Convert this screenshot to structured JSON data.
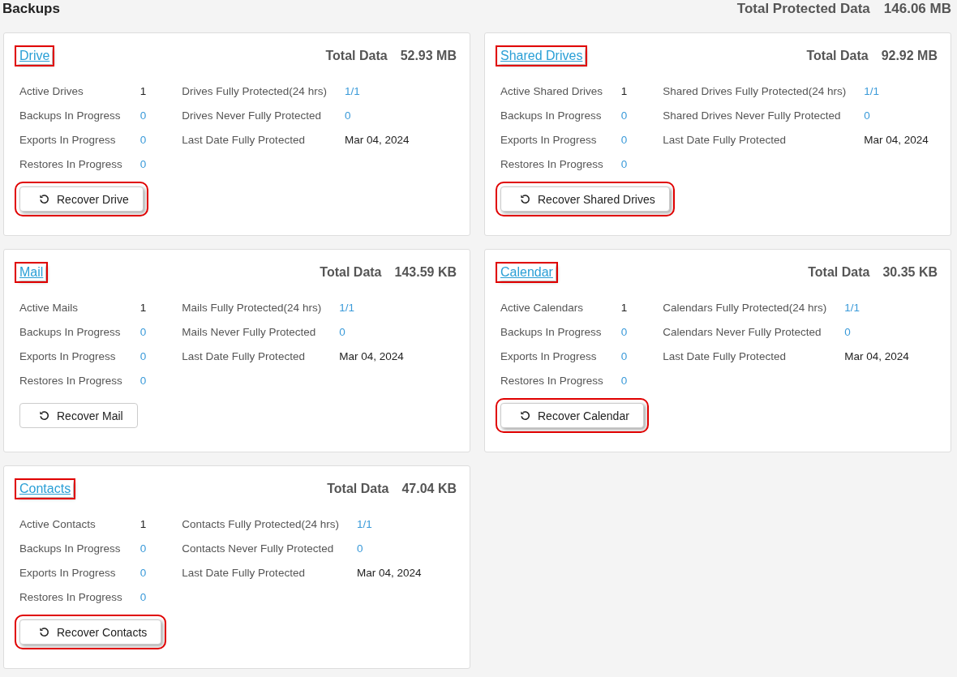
{
  "header": {
    "title": "Backups",
    "total_label": "Total Protected Data",
    "total_value": "146.06 MB"
  },
  "cards": [
    {
      "title": "Drive",
      "title_highlighted": true,
      "total_label": "Total Data",
      "total_value": "52.93 MB",
      "left_stats": [
        {
          "label": "Active Drives",
          "value": "1",
          "link": false
        },
        {
          "label": "Backups In Progress",
          "value": "0",
          "link": true
        },
        {
          "label": "Exports In Progress",
          "value": "0",
          "link": true
        },
        {
          "label": "Restores In Progress",
          "value": "0",
          "link": true
        }
      ],
      "right_stats": [
        {
          "label": "Drives Fully Protected(24 hrs)",
          "value": "1/1",
          "link": true
        },
        {
          "label": "Drives Never Fully Protected",
          "value": "0",
          "link": true
        },
        {
          "label": "Last Date Fully Protected",
          "value": "Mar 04, 2024",
          "link": false
        }
      ],
      "button": {
        "label": "Recover Drive",
        "highlighted": true
      }
    },
    {
      "title": "Shared Drives",
      "title_highlighted": true,
      "total_label": "Total Data",
      "total_value": "92.92 MB",
      "left_stats": [
        {
          "label": "Active Shared Drives",
          "value": "1",
          "link": false
        },
        {
          "label": "Backups In Progress",
          "value": "0",
          "link": true
        },
        {
          "label": "Exports In Progress",
          "value": "0",
          "link": true
        },
        {
          "label": "Restores In Progress",
          "value": "0",
          "link": true
        }
      ],
      "right_stats": [
        {
          "label": "Shared Drives Fully Protected(24 hrs)",
          "value": "1/1",
          "link": true
        },
        {
          "label": "Shared Drives Never Fully Protected",
          "value": "0",
          "link": true
        },
        {
          "label": "Last Date Fully Protected",
          "value": "Mar 04, 2024",
          "link": false
        }
      ],
      "button": {
        "label": "Recover Shared Drives",
        "highlighted": true
      }
    },
    {
      "title": "Mail",
      "title_highlighted": true,
      "total_label": "Total Data",
      "total_value": "143.59 KB",
      "left_stats": [
        {
          "label": "Active Mails",
          "value": "1",
          "link": false
        },
        {
          "label": "Backups In Progress",
          "value": "0",
          "link": true
        },
        {
          "label": "Exports In Progress",
          "value": "0",
          "link": true
        },
        {
          "label": "Restores In Progress",
          "value": "0",
          "link": true
        }
      ],
      "right_stats": [
        {
          "label": "Mails Fully Protected(24 hrs)",
          "value": "1/1",
          "link": true
        },
        {
          "label": "Mails Never Fully Protected",
          "value": "0",
          "link": true
        },
        {
          "label": "Last Date Fully Protected",
          "value": "Mar 04, 2024",
          "link": false
        }
      ],
      "button": {
        "label": "Recover Mail",
        "highlighted": false
      }
    },
    {
      "title": "Calendar",
      "title_highlighted": true,
      "total_label": "Total Data",
      "total_value": "30.35 KB",
      "left_stats": [
        {
          "label": "Active Calendars",
          "value": "1",
          "link": false
        },
        {
          "label": "Backups In Progress",
          "value": "0",
          "link": true
        },
        {
          "label": "Exports In Progress",
          "value": "0",
          "link": true
        },
        {
          "label": "Restores In Progress",
          "value": "0",
          "link": true
        }
      ],
      "right_stats": [
        {
          "label": "Calendars Fully Protected(24 hrs)",
          "value": "1/1",
          "link": true
        },
        {
          "label": "Calendars Never Fully Protected",
          "value": "0",
          "link": true
        },
        {
          "label": "Last Date Fully Protected",
          "value": "Mar 04, 2024",
          "link": false
        }
      ],
      "button": {
        "label": "Recover Calendar",
        "highlighted": true
      }
    },
    {
      "title": "Contacts",
      "title_highlighted": true,
      "total_label": "Total Data",
      "total_value": "47.04 KB",
      "left_stats": [
        {
          "label": "Active Contacts",
          "value": "1",
          "link": false
        },
        {
          "label": "Backups In Progress",
          "value": "0",
          "link": true
        },
        {
          "label": "Exports In Progress",
          "value": "0",
          "link": true
        },
        {
          "label": "Restores In Progress",
          "value": "0",
          "link": true
        }
      ],
      "right_stats": [
        {
          "label": "Contacts Fully Protected(24 hrs)",
          "value": "1/1",
          "link": true
        },
        {
          "label": "Contacts Never Fully Protected",
          "value": "0",
          "link": true
        },
        {
          "label": "Last Date Fully Protected",
          "value": "Mar 04, 2024",
          "link": false
        }
      ],
      "button": {
        "label": "Recover Contacts",
        "highlighted": true
      }
    }
  ]
}
